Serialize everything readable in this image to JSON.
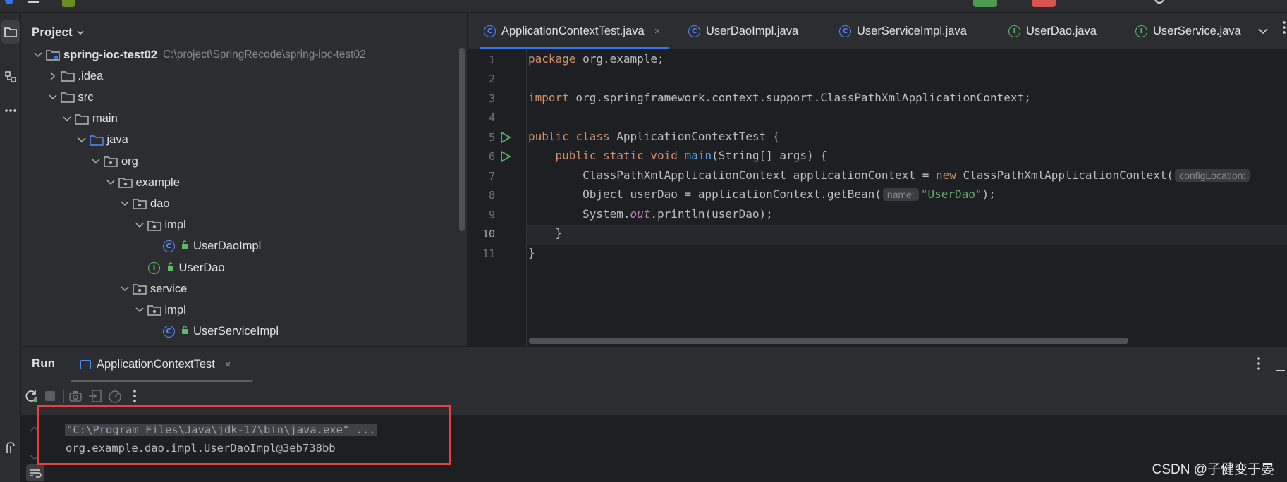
{
  "project": {
    "title": "Project",
    "tree": [
      {
        "label": "spring-ioc-test02",
        "path": "C:\\project\\SpringRecode\\spring-ioc-test02",
        "icon": "module-folder-icon",
        "depth": 0,
        "expanded": true
      },
      {
        "label": ".idea",
        "icon": "folder-icon",
        "depth": 1,
        "expanded": false
      },
      {
        "label": "src",
        "icon": "folder-icon",
        "depth": 1,
        "expanded": true
      },
      {
        "label": "main",
        "icon": "folder-icon",
        "depth": 2,
        "expanded": true
      },
      {
        "label": "java",
        "icon": "source-folder-icon",
        "depth": 3,
        "expanded": true
      },
      {
        "label": "org",
        "icon": "package-icon",
        "depth": 4,
        "expanded": true
      },
      {
        "label": "example",
        "icon": "package-icon",
        "depth": 5,
        "expanded": true
      },
      {
        "label": "dao",
        "icon": "package-icon",
        "depth": 6,
        "expanded": true
      },
      {
        "label": "impl",
        "icon": "package-icon",
        "depth": 7,
        "expanded": true
      },
      {
        "label": "UserDaoImpl",
        "icon": "class-icon",
        "depth": 8,
        "expanded": null
      },
      {
        "label": "UserDao",
        "icon": "interface-icon",
        "depth": 7,
        "expanded": null
      },
      {
        "label": "service",
        "icon": "package-icon",
        "depth": 6,
        "expanded": true
      },
      {
        "label": "impl",
        "icon": "package-icon",
        "depth": 7,
        "expanded": true
      },
      {
        "label": "UserServiceImpl",
        "icon": "class-icon",
        "depth": 8,
        "expanded": null
      }
    ]
  },
  "editor": {
    "tabs": [
      {
        "label": "ApplicationContextTest.java",
        "kind": "class",
        "active": true
      },
      {
        "label": "UserDaoImpl.java",
        "kind": "class",
        "active": false
      },
      {
        "label": "UserServiceImpl.java",
        "kind": "class",
        "active": false
      },
      {
        "label": "UserDao.java",
        "kind": "interface",
        "active": false
      },
      {
        "label": "UserService.java",
        "kind": "interface",
        "active": false
      }
    ],
    "close_glyph": "×",
    "line_numbers": [
      "1",
      "2",
      "3",
      "4",
      "5",
      "6",
      "7",
      "8",
      "9",
      "10",
      "11"
    ],
    "current_line": "10",
    "lines": {
      "l1_kw": "package",
      "l1_rest": " org.example;",
      "l3_kw": "import",
      "l3_rest": " org.springframework.context.support.ClassPathXmlApplicationContext;",
      "l5_kw": "public class",
      "l5_rest": " ApplicationContextTest {",
      "l6_kw": "public static void",
      "l6_fn": "main",
      "l6_rest": "(String[] args) {",
      "l7_a": "ClassPathXmlApplicationContext applicationContext = ",
      "l7_kw": "new",
      "l7_b": " ClassPathXmlApplicationContext(",
      "l7_hint": "configLocation:",
      "l8_a": "Object userDao = applicationContext.getBean(",
      "l8_hint": "name:",
      "l8_q1": "\"",
      "l8_str": "UserDao",
      "l8_q2": "\"",
      "l8_b": ");",
      "l9_a": "System.",
      "l9_it": "out",
      "l9_b": ".println(userDao);",
      "l10": "}",
      "l11": "}"
    }
  },
  "run": {
    "title": "Run",
    "tab_label": "ApplicationContextTest",
    "console": [
      "\"C:\\Program Files\\Java\\jdk-17\\bin\\java.exe\" ...",
      "org.example.dao.impl.UserDaoImpl@3eb738bb"
    ]
  },
  "watermark": "CSDN @子健变于晏",
  "colors": {
    "accent": "#3574f0",
    "highlight_box": "#e8413d",
    "keyword": "#cf8e6d",
    "function": "#56a8f5",
    "string": "#6aab73"
  }
}
